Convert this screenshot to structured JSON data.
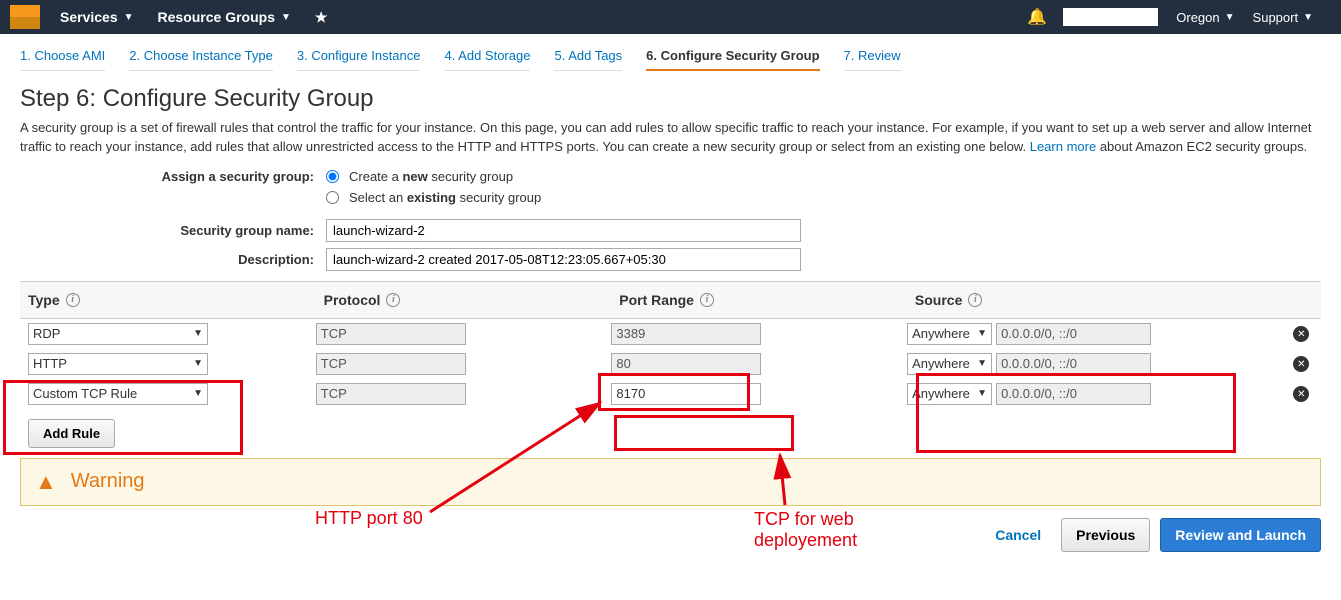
{
  "topnav": {
    "services": "Services",
    "resource_groups": "Resource Groups",
    "region": "Oregon",
    "support": "Support"
  },
  "wizard": {
    "tabs": [
      "1. Choose AMI",
      "2. Choose Instance Type",
      "3. Configure Instance",
      "4. Add Storage",
      "5. Add Tags",
      "6. Configure Security Group",
      "7. Review"
    ],
    "active_index": 5
  },
  "heading": "Step 6: Configure Security Group",
  "description": "A security group is a set of firewall rules that control the traffic for your instance. On this page, you can add rules to allow specific traffic to reach your instance. For example, if you want to set up a web server and allow Internet traffic to reach your instance, add rules that allow unrestricted access to the HTTP and HTTPS ports. You can create a new security group or select from an existing one below.",
  "learn_more": "Learn more",
  "description_suffix": "about Amazon EC2 security groups.",
  "form": {
    "assign_label": "Assign a security group:",
    "create_option_prefix": "Create a ",
    "create_option_bold": "new",
    "create_option_suffix": " security group",
    "select_option_prefix": "Select an ",
    "select_option_bold": "existing",
    "select_option_suffix": " security group",
    "name_label": "Security group name:",
    "name_value": "launch-wizard-2",
    "desc_label": "Description:",
    "desc_value": "launch-wizard-2 created 2017-05-08T12:23:05.667+05:30"
  },
  "table": {
    "headers": {
      "type": "Type",
      "protocol": "Protocol",
      "port": "Port Range",
      "source": "Source"
    },
    "rows": [
      {
        "type": "RDP",
        "protocol": "TCP",
        "port": "3389",
        "port_editable": false,
        "src_sel": "Anywhere",
        "src_val": "0.0.0.0/0, ::/0"
      },
      {
        "type": "HTTP",
        "protocol": "TCP",
        "port": "80",
        "port_editable": false,
        "src_sel": "Anywhere",
        "src_val": "0.0.0.0/0, ::/0"
      },
      {
        "type": "Custom TCP Rule",
        "protocol": "TCP",
        "port": "8170",
        "port_editable": true,
        "src_sel": "Anywhere",
        "src_val": "0.0.0.0/0, ::/0"
      }
    ],
    "add_rule": "Add Rule"
  },
  "annotations": {
    "http_port": "HTTP port 80",
    "tcp_web1": "TCP for web",
    "tcp_web2": "deployement"
  },
  "warning": {
    "label": "Warning"
  },
  "footer": {
    "cancel": "Cancel",
    "previous": "Previous",
    "review": "Review and Launch"
  }
}
